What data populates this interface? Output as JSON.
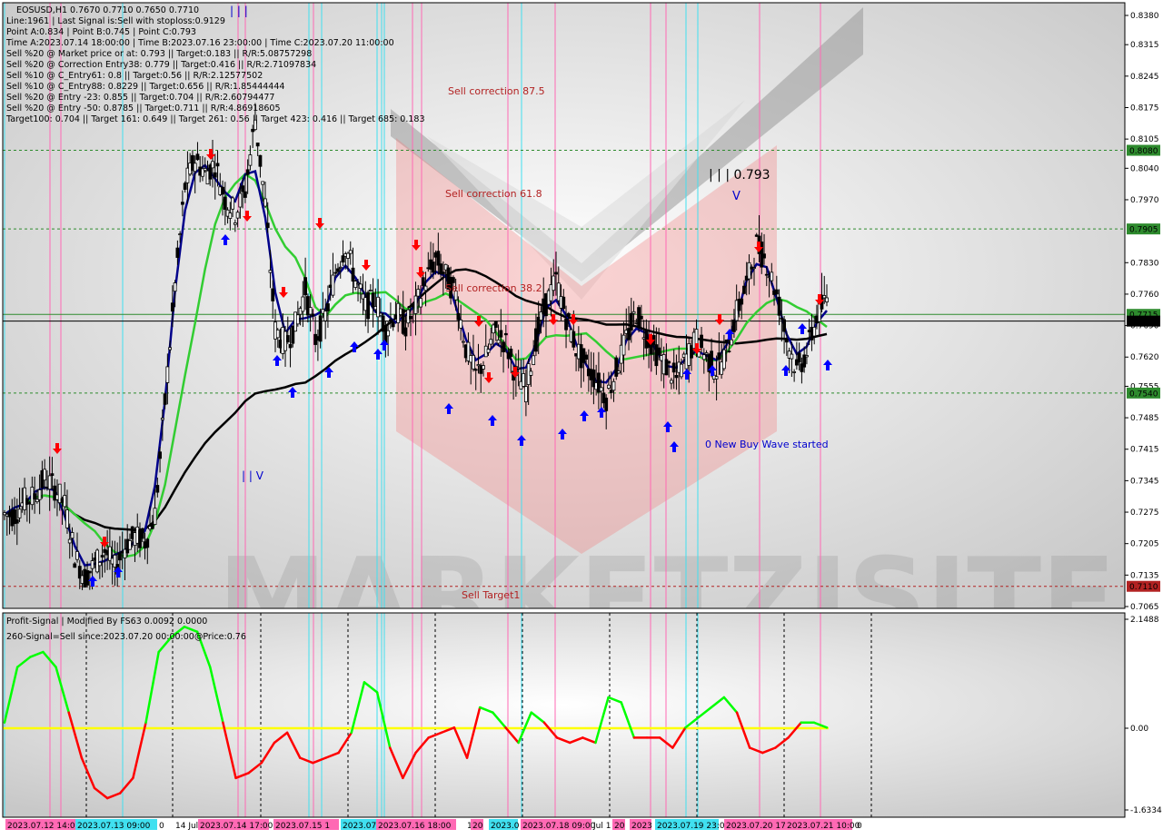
{
  "header": {
    "symbol_line": "EOSUSD,H1  0.7670 0.7710 0.7650 0.7710",
    "info_lines": [
      "Line:1961 | Last Signal is:Sell with stoploss:0.9129",
      "Point A:0.834 | Point B:0.745 | Point C:0.793",
      "Time A:2023.07.14 18:00:00 | Time B:2023.07.16 23:00:00 | Time C:2023.07.20 11:00:00",
      "Sell %20 @ Market price or at: 0.793 || Target:0.183 || R/R:5.08757298",
      "Sell %20 @ Correction Entry38: 0.779 || Target:0.416 || R/R:2.71097834",
      "Sell %10 @ C_Entry61: 0.8 || Target:0.56 || R/R:2.12577502",
      "Sell %10 @ C_Entry88: 0.8229 || Target:0.656 || R/R:1.85444444",
      "Sell %20 @ Entry -23: 0.855 || Target:0.704 || R/R:2.60794477",
      "Sell %20 @ Entry -50: 0.8785 || Target:0.711 || R/R:4.86918605",
      "Target100: 0.704 || Target 161: 0.649 || Target 261: 0.56 || Target 423: 0.416 || Target 685: 0.183"
    ]
  },
  "annotations": {
    "sell_correction_875": "Sell correction 87.5",
    "sell_correction_618": "Sell correction 61.8",
    "sell_correction_382": "Sell correction 38.2",
    "point_c_label": "| | | 0.793",
    "point_c_marker": "V",
    "point_a_marker": "| | |",
    "point_b_label": "| | V",
    "buy_wave": "0 New Buy Wave started",
    "sell_target": "Sell Target1",
    "watermark": "MARKETZISITE"
  },
  "price_axis": {
    "ticks": [
      "0.8380",
      "0.8315",
      "0.8245",
      "0.8175",
      "0.8105",
      "0.8040",
      "0.7970",
      "0.7830",
      "0.7760",
      "0.7690",
      "0.7620",
      "0.7555",
      "0.7485",
      "0.7415",
      "0.7345",
      "0.7275",
      "0.7205",
      "0.7135",
      "0.7065"
    ],
    "badges": [
      {
        "text": "0.8080",
        "color": "#2e8b2e"
      },
      {
        "text": "0.7905",
        "color": "#2e8b2e"
      },
      {
        "text": "0.7715",
        "color": "#2e8b2e"
      },
      {
        "text": "0.7700",
        "color": "#000000"
      },
      {
        "text": "0.7540",
        "color": "#2e8b2e"
      },
      {
        "text": "0.7110",
        "color": "#b22222"
      }
    ]
  },
  "indicator": {
    "title": "Profit-Signal | Modified By FS63 0.0092 0.0000",
    "signal": "260-Signal=Sell since:2023.07.20 00:00:00@Price:0.76",
    "axis_ticks": [
      "2.1488",
      "0.00",
      "-1.6334"
    ]
  },
  "time_axis": {
    "labels": [
      {
        "text": "2023.07.12 14:00",
        "bg": "#ff69b4"
      },
      {
        "text": "2023.07.13 09:00",
        "bg": "#40e0f0"
      },
      {
        "text": "0",
        "bg": ""
      },
      {
        "text": "14 Jul",
        "bg": ""
      },
      {
        "text": "2023.07.14 17:00",
        "bg": "#ff69b4"
      },
      {
        "text": "2023.07.15 1",
        "bg": "#ff69b4"
      },
      {
        "text": "2023.07",
        "bg": "#40e0f0"
      },
      {
        "text": "2023.07.16 18:00",
        "bg": "#ff69b4"
      },
      {
        "text": "1",
        "bg": ""
      },
      {
        "text": "20",
        "bg": "#ff69b4"
      },
      {
        "text": "2023.0",
        "bg": "#40e0f0"
      },
      {
        "text": "2023.07.18 09:00",
        "bg": "#ff69b4"
      },
      {
        "text": "Jul 1",
        "bg": ""
      },
      {
        "text": "20",
        "bg": "#ff69b4"
      },
      {
        "text": "2023",
        "bg": "#ff69b4"
      },
      {
        "text": "2023.07.19 23:0",
        "bg": "#40e0f0"
      },
      {
        "text": "2023.07.20 17:0",
        "bg": "#ff69b4"
      },
      {
        "text": "2023.07.21 10:00",
        "bg": "#ff69b4"
      },
      {
        "text": "0",
        "bg": ""
      }
    ]
  },
  "colors": {
    "background": "#ffffff",
    "pattern_fill": "#f08080",
    "cyan_line": "#40e0f0",
    "pink_line": "#ff69b4",
    "sell_arrow": "#ff0000",
    "buy_arrow": "#0000ff",
    "ma_fast": "#00008b",
    "ma_mid": "#32cd32",
    "ma_slow": "#000000",
    "osc_up": "#00ff00",
    "osc_down": "#ff0000",
    "zero_line": "#ffff00"
  },
  "chart_data": {
    "type": "candlestick",
    "symbol": "EOSUSD,H1",
    "ohlc": {
      "open": 0.767,
      "high": 0.771,
      "low": 0.765,
      "close": 0.771
    },
    "levels": [
      {
        "value": 0.808,
        "color": "#2e8b2e",
        "style": "dotted"
      },
      {
        "value": 0.7905,
        "color": "#2e8b2e",
        "style": "dotted"
      },
      {
        "value": 0.7715,
        "color": "#2e8b2e",
        "style": "solid"
      },
      {
        "value": 0.77,
        "color": "#000000",
        "style": "solid"
      },
      {
        "value": 0.754,
        "color": "#2e8b2e",
        "style": "dotted"
      },
      {
        "value": 0.711,
        "color": "#b22222",
        "style": "dotted"
      }
    ],
    "ylim": [
      0.7065,
      0.838
    ],
    "approx_close_path": [
      0.727,
      0.73,
      0.731,
      0.735,
      0.733,
      0.729,
      0.718,
      0.713,
      0.716,
      0.719,
      0.715,
      0.72,
      0.722,
      0.721,
      0.727,
      0.752,
      0.778,
      0.8,
      0.806,
      0.803,
      0.805,
      0.797,
      0.794,
      0.799,
      0.815,
      0.796,
      0.768,
      0.765,
      0.769,
      0.777,
      0.766,
      0.771,
      0.781,
      0.787,
      0.779,
      0.773,
      0.775,
      0.768,
      0.772,
      0.769,
      0.773,
      0.779,
      0.784,
      0.78,
      0.776,
      0.764,
      0.758,
      0.762,
      0.768,
      0.765,
      0.758,
      0.755,
      0.766,
      0.774,
      0.779,
      0.771,
      0.764,
      0.76,
      0.757,
      0.753,
      0.759,
      0.766,
      0.772,
      0.767,
      0.763,
      0.76,
      0.757,
      0.762,
      0.766,
      0.762,
      0.759,
      0.763,
      0.772,
      0.778,
      0.787,
      0.783,
      0.776,
      0.766,
      0.759,
      0.763,
      0.771,
      0.775,
      0.771
    ],
    "oscillator": {
      "ylim": [
        -1.6334,
        2.1488
      ],
      "zero": 0.0
    }
  }
}
